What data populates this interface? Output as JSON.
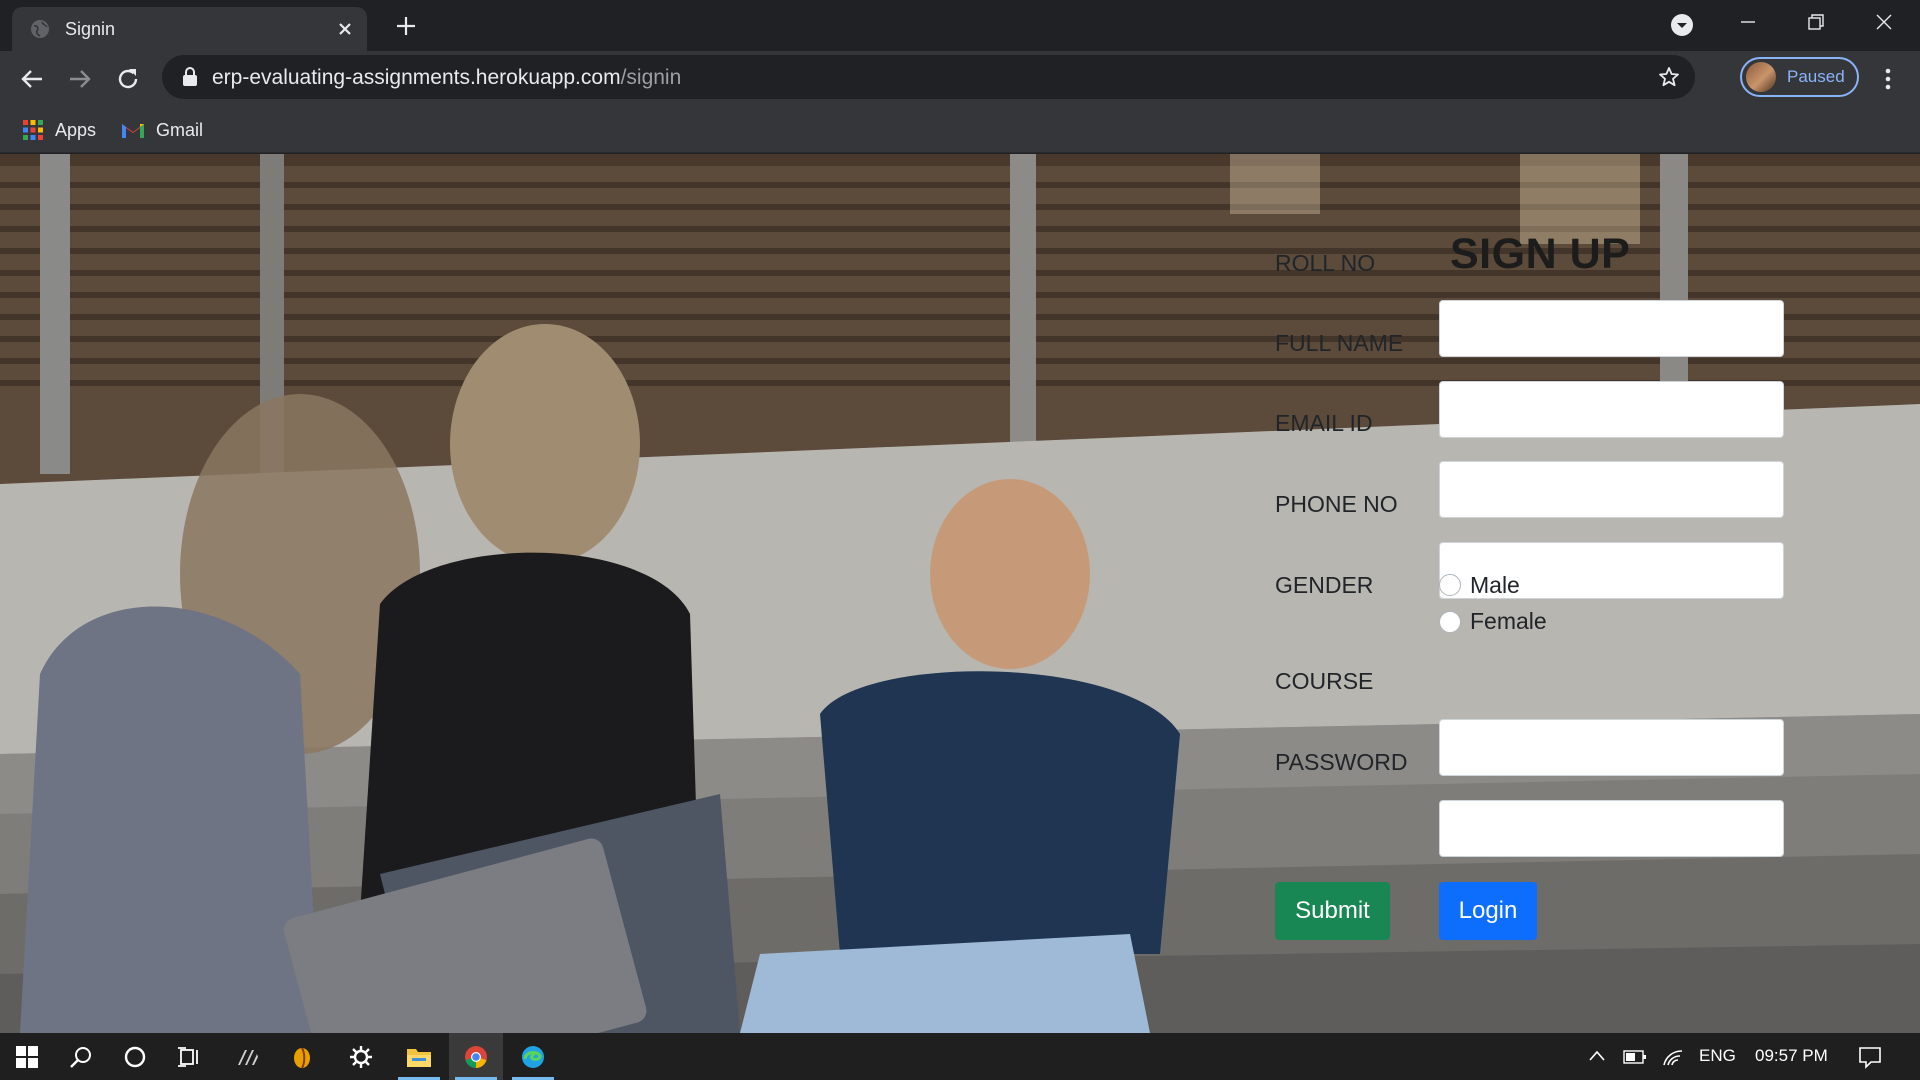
{
  "browser": {
    "tab_title": "Signin",
    "url_host": "erp-evaluating-assignments.herokuapp.com",
    "url_path": "/signin",
    "profile_label": "Paused",
    "bookmarks": [
      {
        "label": "Apps",
        "icon": "apps-grid-icon"
      },
      {
        "label": "Gmail",
        "icon": "gmail-icon"
      }
    ]
  },
  "form": {
    "title": "SIGN UP",
    "fields": {
      "roll_no": {
        "label": "ROLL NO",
        "value": ""
      },
      "full_name": {
        "label": "FULL NAME",
        "value": ""
      },
      "email": {
        "label": "EMAIL ID",
        "value": ""
      },
      "phone": {
        "label": "PHONE NO",
        "value": ""
      },
      "course": {
        "label": "COURSE",
        "value": ""
      },
      "password": {
        "label": "PASSWORD",
        "value": ""
      }
    },
    "gender": {
      "label": "GENDER",
      "options": [
        "Male",
        "Female"
      ],
      "selected": null
    },
    "submit_label": "Submit",
    "login_label": "Login",
    "colors": {
      "submit": "#198754",
      "login": "#0d6efd"
    }
  },
  "taskbar": {
    "language": "ENG",
    "time": "09:57 PM",
    "apps": [
      "windows-start-icon",
      "search-icon",
      "cortana-icon",
      "task-view-icon",
      "app-icon",
      "browser-icon",
      "settings-icon",
      "file-explorer-icon",
      "chrome-icon",
      "edge-icon"
    ]
  }
}
